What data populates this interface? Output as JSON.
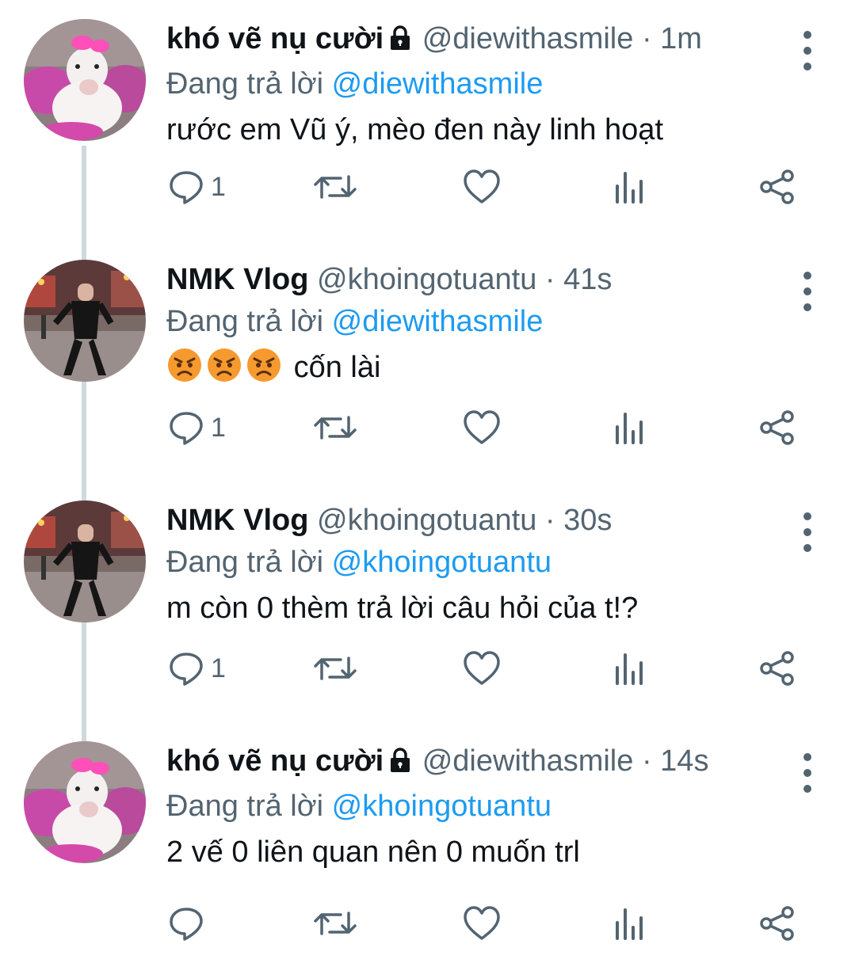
{
  "tweets": [
    {
      "display_name": "khó vẽ nụ cười",
      "locked": true,
      "handle": "@diewithasmile",
      "separator": "·",
      "time": "1m",
      "reply_prefix": "Đang trả lời",
      "reply_to": "@diewithasmile",
      "text": "rước em Vũ ý, mèo đen này linh hoạt",
      "reply_count": "1",
      "avatar": "dog-avatar"
    },
    {
      "display_name": "NMK Vlog",
      "locked": false,
      "handle": "@khoingotuantu",
      "separator": "·",
      "time": "41s",
      "reply_prefix": "Đang trả lời",
      "reply_to": "@diewithasmile",
      "text": "cốn lài",
      "emoji": [
        "angry-face-icon",
        "angry-face-icon",
        "angry-face-icon"
      ],
      "reply_count": "1",
      "avatar": "street-man-avatar"
    },
    {
      "display_name": "NMK Vlog",
      "locked": false,
      "handle": "@khoingotuantu",
      "separator": "·",
      "time": "30s",
      "reply_prefix": "Đang trả lời",
      "reply_to": "@khoingotuantu",
      "text": "m còn 0 thèm trả lời câu hỏi của t!?",
      "reply_count": "1",
      "avatar": "street-man-avatar"
    },
    {
      "display_name": "khó vẽ nụ cười",
      "locked": true,
      "handle": "@diewithasmile",
      "separator": "·",
      "time": "14s",
      "reply_prefix": "Đang trả lời",
      "reply_to": "@khoingotuantu",
      "text": "2 vế 0 liên quan nên 0 muốn trl",
      "reply_count": "",
      "avatar": "dog-avatar"
    }
  ],
  "colors": {
    "text": "#0f1419",
    "secondary": "#536471",
    "mention": "#1d9bf0",
    "thread_line": "#cfd9de"
  },
  "icons": [
    "reply-icon",
    "retweet-icon",
    "like-icon",
    "views-icon",
    "share-icon",
    "more-icon",
    "lock-icon"
  ]
}
